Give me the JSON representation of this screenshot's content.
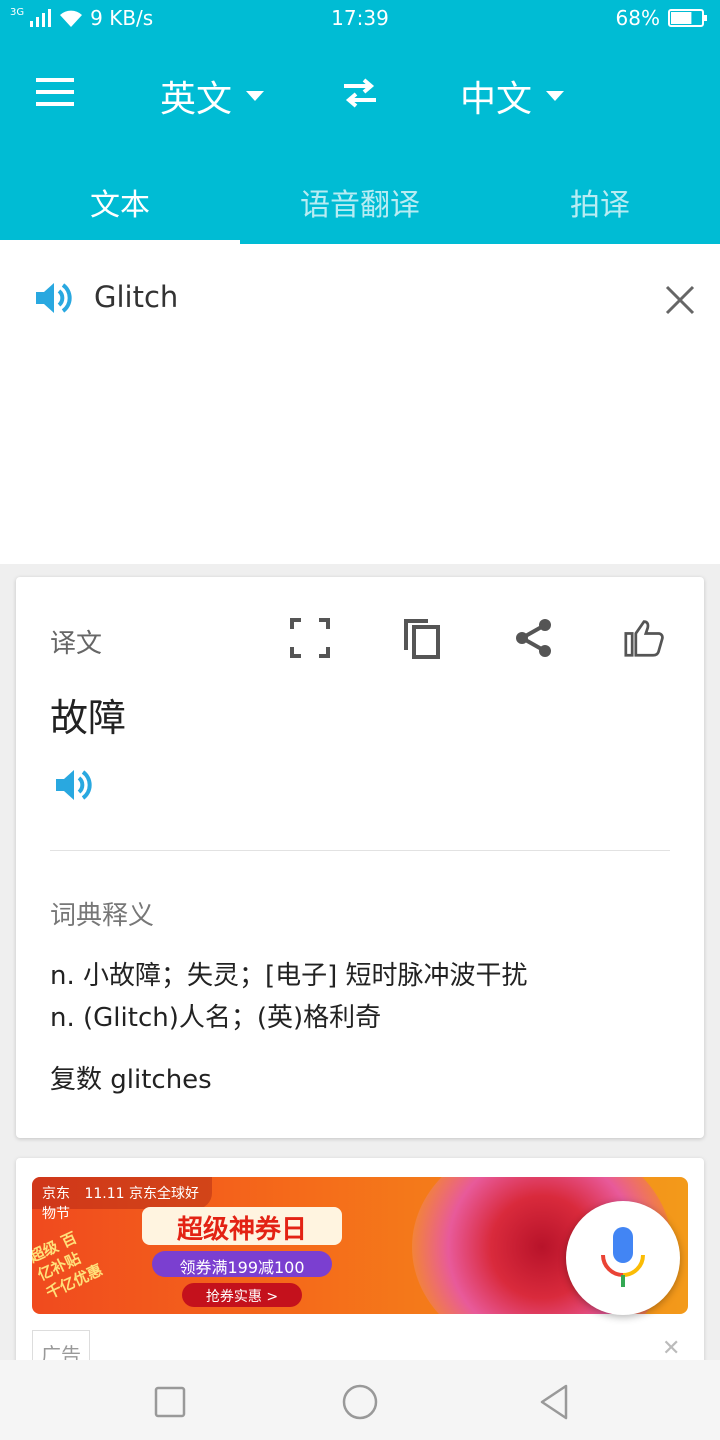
{
  "status_bar": {
    "network": "3G",
    "speed": "9 KB/s",
    "time": "17:39",
    "battery": "68%",
    "battery_level": 0.68
  },
  "toolbar": {
    "source_language": "英文",
    "target_language": "中文"
  },
  "tabs": [
    {
      "label": "文本",
      "active": true
    },
    {
      "label": "语音翻译",
      "active": false
    },
    {
      "label": "拍译",
      "active": false
    }
  ],
  "input": {
    "text": "Glitch"
  },
  "result": {
    "label": "译文",
    "translation": "故障",
    "dict_label": "词典释义",
    "definitions": [
      "n. 小故障；失灵；[电子] 短时脉冲波干扰",
      "n. (Glitch)人名；(英)格利奇"
    ],
    "plural": "复数 glitches"
  },
  "ad": {
    "brand": "京东",
    "event": "11.11 京东全球好物节",
    "headline": "超级神券日",
    "coupon": "领券满199减100",
    "cta": "抢券实惠 >",
    "side_text": "超级 百亿补贴 千亿优惠",
    "tag": "广告"
  },
  "colors": {
    "accent": "#00bcd4",
    "speaker_blue": "#29a8e0"
  }
}
